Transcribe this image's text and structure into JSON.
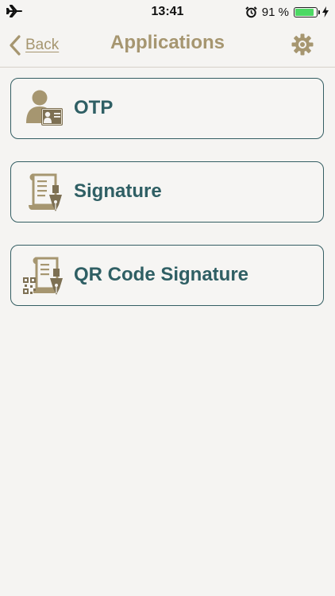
{
  "status_bar": {
    "time": "13:41",
    "battery_percent_text": "91 %",
    "battery_level": 0.91,
    "icons": [
      "airplane-icon",
      "alarm-icon",
      "battery-icon",
      "charging-icon"
    ]
  },
  "nav": {
    "back_label": "Back",
    "title": "Applications",
    "settings_icon": "gear-icon"
  },
  "apps": [
    {
      "label": "OTP",
      "icon": "person-id-card-icon"
    },
    {
      "label": "Signature",
      "icon": "document-pen-icon"
    },
    {
      "label": "QR Code Signature",
      "icon": "qr-document-pen-icon"
    }
  ],
  "colors": {
    "accent_gold": "#a69670",
    "teal_text": "#2f5f64",
    "border_teal": "#345e63",
    "background": "#f5f4f2",
    "battery_green": "#4cd964"
  }
}
